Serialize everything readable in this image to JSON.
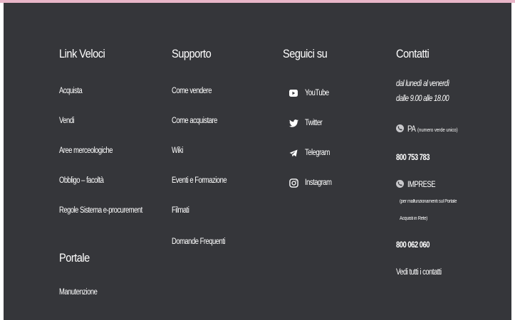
{
  "colors": {
    "background": "#35363a",
    "text": "#ffffff",
    "accent_bar": "#e9b6c8"
  },
  "links_column": {
    "title": "Link Veloci",
    "items": [
      "Acquista",
      "Vendi",
      "Aree merceologiche",
      "Obbligo – facoltà",
      "Regole Sistema e-procurement"
    ]
  },
  "portale": {
    "title": "Portale",
    "items": [
      "Manutenzione"
    ]
  },
  "support_column": {
    "title": "Supporto",
    "items": [
      "Come vendere",
      "Come acquistare",
      "Wiki",
      "Eventi e Formazione",
      "Filmati",
      "Domande Frequenti"
    ]
  },
  "social_column": {
    "title": "Seguici su",
    "items": [
      {
        "label": "YouTube",
        "icon": "youtube-icon"
      },
      {
        "label": "Twitter",
        "icon": "twitter-icon"
      },
      {
        "label": "Telegram",
        "icon": "telegram-icon"
      },
      {
        "label": "Instagram",
        "icon": "instagram-icon"
      }
    ]
  },
  "contacts_column": {
    "title": "Contatti",
    "hours_line1": "dal lunedì al venerdì",
    "hours_line2": "dalle 9.00 alle 18.00",
    "pa_label": "PA",
    "pa_note": "(numero verde unico)",
    "pa_phone": "800 753 783",
    "imprese_label": "IMPRESE",
    "imprese_note_line1": "(per malfunzionamenti sul Portale",
    "imprese_note_line2": "Acquisti in Rete)",
    "imprese_phone": "800 062 060",
    "all_contacts": "Vedi tutti i contatti"
  }
}
